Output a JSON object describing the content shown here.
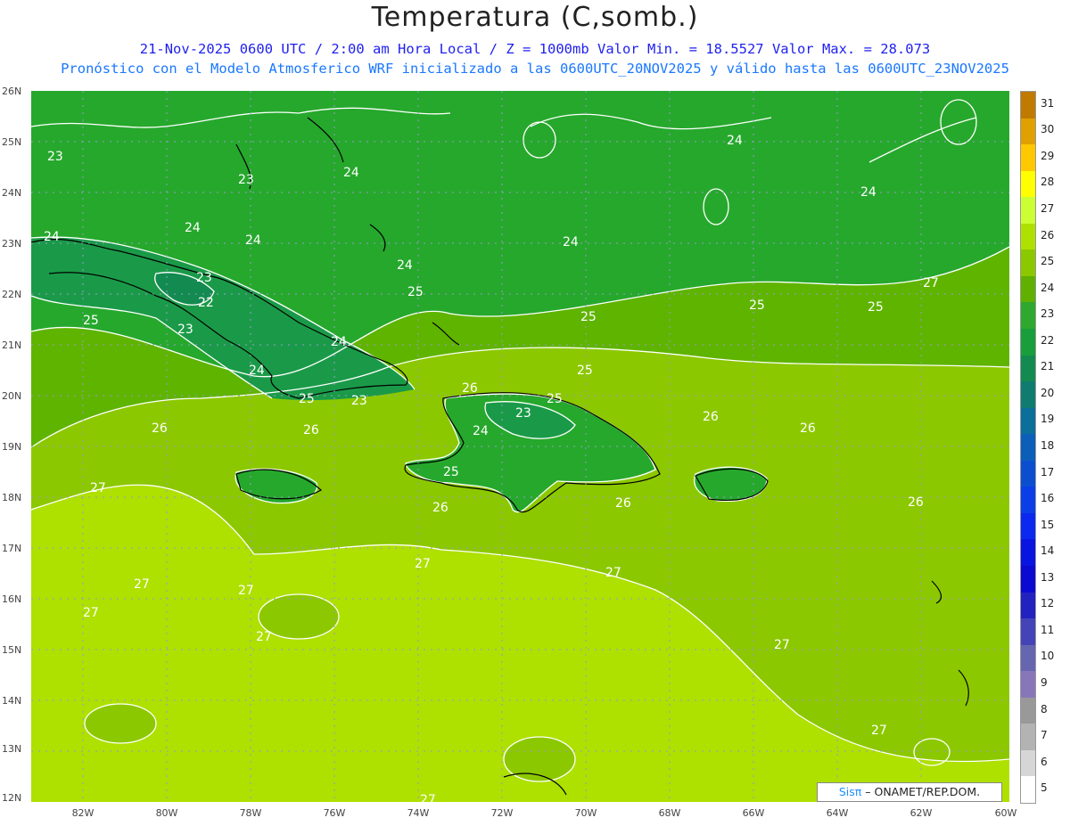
{
  "header": {
    "title": "Temperatura (C,somb.)",
    "line1": "21-Nov-2025  0600 UTC / 2:00 am Hora Local / Z = 1000mb     Valor Min. = 18.5527  Valor Max. = 28.073",
    "line2": "Pronóstico con el Modelo Atmosferico WRF inicializado a las 0600UTC_20NOV2025 y válido hasta las  0600UTC_23NOV2025"
  },
  "axes": {
    "lat_labels": [
      "26N",
      "25N",
      "24N",
      "23N",
      "22N",
      "21N",
      "20N",
      "19N",
      "18N",
      "17N",
      "16N",
      "15N",
      "14N",
      "13N",
      "12N"
    ],
    "lon_labels": [
      "82W",
      "80W",
      "78W",
      "76W",
      "74W",
      "72W",
      "70W",
      "68W",
      "66W",
      "64W",
      "62W",
      "60W"
    ]
  },
  "colorbar": {
    "labels": [
      "31",
      "30",
      "29",
      "28",
      "27",
      "26",
      "25",
      "24",
      "23",
      "22",
      "21",
      "20",
      "19",
      "18",
      "17",
      "16",
      "15",
      "14",
      "13",
      "12",
      "11",
      "10",
      "9",
      "8",
      "7",
      "6",
      "5"
    ],
    "colors": [
      "#c07a00",
      "#e0a000",
      "#ffc800",
      "#ffff00",
      "#ccff33",
      "#aee000",
      "#8cc800",
      "#5fb000",
      "#2ea82e",
      "#199e3c",
      "#138a50",
      "#107c70",
      "#0a6f9a",
      "#0b5fb8",
      "#0b4fd0",
      "#0a3ee6",
      "#0a28f0",
      "#0a14e0",
      "#0a0ad0",
      "#2222c0",
      "#4444b8",
      "#6666b0",
      "#8877b8",
      "#999999",
      "#b3b3b3",
      "#d6d6d6",
      "#ffffff"
    ]
  },
  "contour_labels": [
    "23",
    "23",
    "24",
    "24",
    "24",
    "24",
    "24",
    "24",
    "24",
    "24",
    "25",
    "25",
    "25",
    "25",
    "25",
    "25",
    "23",
    "22",
    "23",
    "24",
    "24",
    "25",
    "23",
    "26",
    "25",
    "23",
    "24",
    "25",
    "26",
    "26",
    "26",
    "26",
    "26",
    "26",
    "26",
    "27",
    "27",
    "27",
    "27",
    "27",
    "27",
    "27",
    "27",
    "27",
    "27",
    "27"
  ],
  "credit": {
    "sis": "Sisπ",
    "rest": " – ONAMET/REP.DOM."
  },
  "colors": {
    "band_24": "#26a82c",
    "band_25": "#5fb400",
    "band_26": "#8cc800",
    "band_27": "#aee000",
    "band_23": "#1a9a48",
    "band_22": "#138a50",
    "contour": "#ffffff",
    "coast": "#000000",
    "grid": "#9999cc"
  }
}
